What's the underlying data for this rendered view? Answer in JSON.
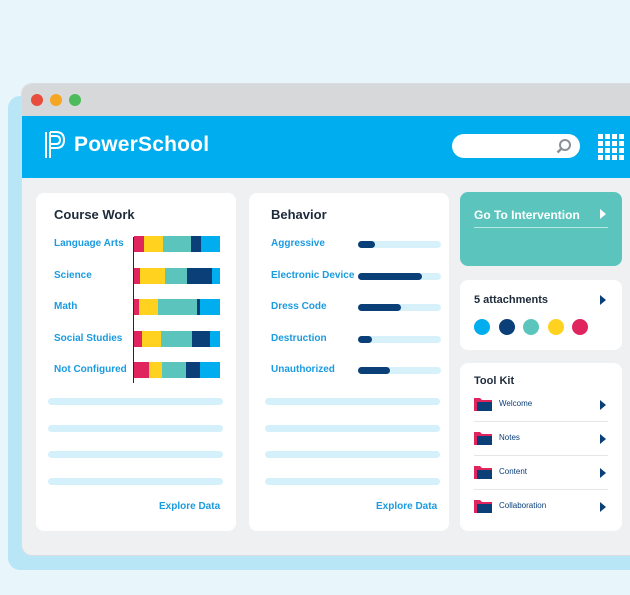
{
  "app": {
    "name": "PowerSchool"
  },
  "window": {
    "dots": [
      "#e84c3d",
      "#f5a623",
      "#4cbb5a"
    ]
  },
  "search": {
    "placeholder": ""
  },
  "course_work": {
    "title": "Course Work",
    "rows": [
      {
        "label": "Language Arts",
        "segments": [
          [
            10,
            "#e0245e"
          ],
          [
            20,
            "#ffd21f"
          ],
          [
            30,
            "#5bc5bd"
          ],
          [
            10,
            "#0a3f78"
          ],
          [
            20,
            "#00aeef"
          ]
        ]
      },
      {
        "label": "Science",
        "segments": [
          [
            6,
            "#e0245e"
          ],
          [
            26,
            "#ffd21f"
          ],
          [
            22,
            "#5bc5bd"
          ],
          [
            26,
            "#0a3f78"
          ],
          [
            8,
            "#00aeef"
          ]
        ]
      },
      {
        "label": "Math",
        "segments": [
          [
            5,
            "#e0245e"
          ],
          [
            19,
            "#ffd21f"
          ],
          [
            40,
            "#5bc5bd"
          ],
          [
            3,
            "#0a3f78"
          ],
          [
            20,
            "#00aeef"
          ]
        ]
      },
      {
        "label": "Social Studies",
        "segments": [
          [
            8,
            "#e0245e"
          ],
          [
            20,
            "#ffd21f"
          ],
          [
            33,
            "#5bc5bd"
          ],
          [
            19,
            "#0a3f78"
          ],
          [
            10,
            "#00aeef"
          ]
        ]
      },
      {
        "label": "Not Configured",
        "segments": [
          [
            15,
            "#e0245e"
          ],
          [
            13,
            "#ffd21f"
          ],
          [
            25,
            "#5bc5bd"
          ],
          [
            14,
            "#0a3f78"
          ],
          [
            20,
            "#00aeef"
          ]
        ]
      }
    ],
    "explore": "Explore Data"
  },
  "behavior": {
    "title": "Behavior",
    "rows": [
      {
        "label": "Aggressive",
        "value": 0.2
      },
      {
        "label": "Electronic Device",
        "value": 0.77
      },
      {
        "label": "Dress Code",
        "value": 0.52
      },
      {
        "label": "Destruction",
        "value": 0.17
      },
      {
        "label": "Unauthorized",
        "value": 0.39
      }
    ],
    "explore": "Explore Data"
  },
  "intervention": {
    "label": "Go To Intervention"
  },
  "attachments": {
    "label": "5 attachments",
    "colors": [
      "#00aeef",
      "#0a3f78",
      "#5bc5bd",
      "#ffd21f",
      "#e0245e"
    ]
  },
  "toolkit": {
    "title": "Tool Kit",
    "items": [
      {
        "label": "Welcome"
      },
      {
        "label": "Notes"
      },
      {
        "label": "Content"
      },
      {
        "label": "Collaboration"
      }
    ]
  }
}
